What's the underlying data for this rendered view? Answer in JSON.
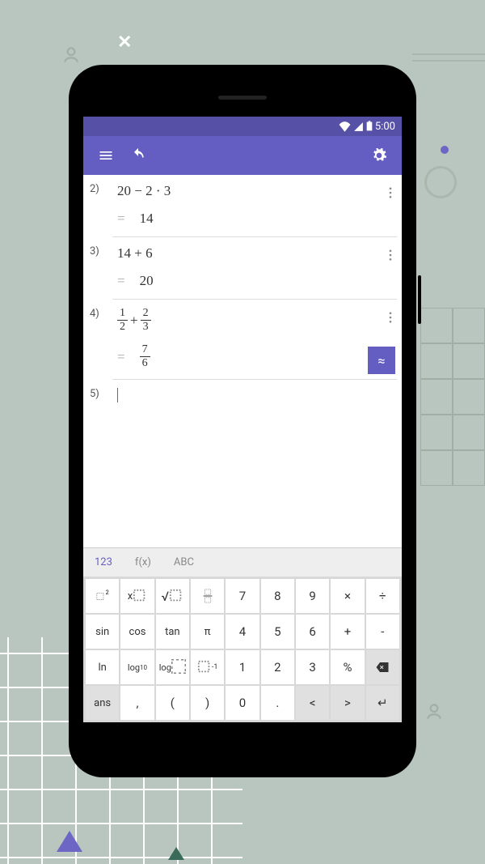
{
  "statusbar": {
    "time": "5:00"
  },
  "calc": {
    "rows": [
      {
        "num": "2)",
        "expr": "20 − 2 · 3",
        "result": "14"
      },
      {
        "num": "3)",
        "expr": "14 + 6",
        "result": "20"
      },
      {
        "num": "4)",
        "frac1_n": "1",
        "frac1_d": "2",
        "op": "+",
        "frac2_n": "2",
        "frac2_d": "3",
        "res_n": "7",
        "res_d": "6",
        "approx": "≈"
      },
      {
        "num": "5)"
      }
    ]
  },
  "kb_tabs": {
    "t1": "123",
    "t2": "f(x)",
    "t3": "ABC"
  },
  "keys": {
    "r1": {
      "k1": "☐²",
      "k2": "x☐",
      "k3": "√☐",
      "k4": "☐/☐",
      "k5": "7",
      "k6": "8",
      "k7": "9",
      "k8": "×",
      "k9": "÷"
    },
    "r2": {
      "k1": "sin",
      "k2": "cos",
      "k3": "tan",
      "k4": "π",
      "k5": "4",
      "k6": "5",
      "k7": "6",
      "k8": "+",
      "k9": "-"
    },
    "r3": {
      "k1": "ln",
      "k2": "log₁₀",
      "k3": "log☐",
      "k4": "☐⁻¹",
      "k5": "1",
      "k6": "2",
      "k7": "3",
      "k8": "%",
      "k9": "⌫"
    },
    "r4": {
      "k1": "ans",
      "k2": ",",
      "k3": "(",
      "k4": ")",
      "k5": "0",
      "k6": ".",
      "k7": "<",
      "k8": ">",
      "k9": "↵"
    }
  }
}
